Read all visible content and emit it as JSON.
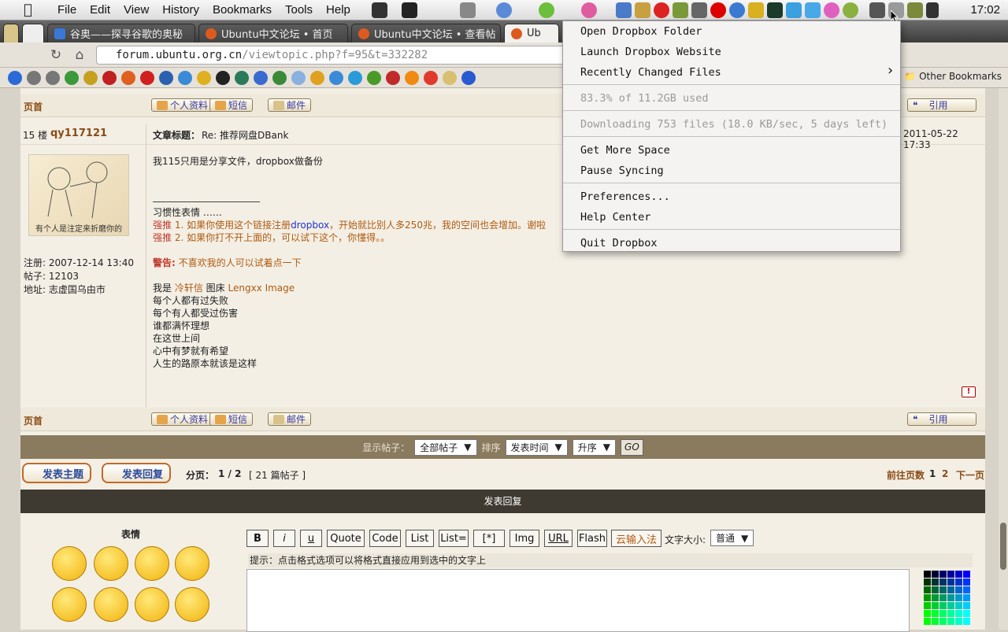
{
  "menubar": {
    "items": [
      "File",
      "Edit",
      "View",
      "History",
      "Bookmarks",
      "Tools",
      "Help"
    ],
    "clock": "17:02"
  },
  "tabs": [
    {
      "label": "谷奥——探寻谷歌的奥秘",
      "color": "#3a78d8"
    },
    {
      "label": "Ubuntu中文论坛 • 首页",
      "color": "#dd5a1e"
    },
    {
      "label": "Ubuntu中文论坛 • 查看帖",
      "color": "#dd5a1e"
    },
    {
      "label": "Ub",
      "color": "#dd5a1e"
    }
  ],
  "address": {
    "host": "forum.ubuntu.org.cn",
    "path": "/viewtopic.php?f=95&t=332282"
  },
  "bookmarks": {
    "other": "Other Bookmarks"
  },
  "post_top": {
    "label": "页首",
    "profile": "个人资料",
    "pm": "短信",
    "email": "邮件",
    "quote": "引用"
  },
  "post": {
    "floor": "15 楼",
    "author": "qy117121",
    "title_label": "文章标题：",
    "title": "Re: 推荐网盘DBank",
    "date": "2011-05-22 17:33",
    "avatar_caption": "有个人是注定来折磨你的",
    "register": "注册: 2007-12-14 13:40",
    "posts": "帖子: 12103",
    "location": "地址: 志虚国乌由市",
    "content": "我115只用是分享文件，dropbox做备份",
    "sig_habit": "习惯性表情 ……",
    "rec_label": "强推",
    "rec1_a": " 1. 如果你使用这个链接注册",
    "rec1_link": "dropbox",
    "rec1_b": "，开始就比别人多250兆，我的空间也会增加。谢啦",
    "rec2": " 2. 如果你打不开上面的，可以试下这个，你懂得。。",
    "warn_label": "警告:",
    "warn": " 不喜欢我的人可以试着点一下",
    "me_prefix": "我是 ",
    "me_name": "冷轩信",
    "me_mid": " 图床 ",
    "me_img": "Lengxx Image",
    "poem": [
      "每个人都有过失败",
      "每个有人都受过伤害",
      "谁都满怀理想",
      "在这世上间",
      "心中有梦就有希望",
      "人生的路原本就该是这样"
    ]
  },
  "post_bottom": {
    "label": "页首",
    "profile": "个人资料",
    "pm": "短信",
    "email": "邮件",
    "quote": "引用"
  },
  "filter": {
    "show_label": "显示帖子：",
    "show_value": "全部帖子",
    "sort_label": "排序",
    "sort_value": "发表时间",
    "order_value": "升序",
    "go": "GO"
  },
  "actions": {
    "new_topic": "发表主题",
    "reply": "发表回复",
    "pages_label": "分页：",
    "pages": "1 / 2",
    "count": "[ 21 篇帖子 ]",
    "goto_label": "前往页数",
    "page1": "1",
    "page2": "2",
    "next": "下一页"
  },
  "reply_header": "发表回复",
  "editor": {
    "smilies_label": "表情",
    "buttons": [
      "B",
      "i",
      "u",
      "Quote",
      "Code",
      "List",
      "List=",
      "[*]",
      "Img",
      "URL",
      "Flash",
      "云输入法"
    ],
    "fontsize_label": "文字大小:",
    "fontsize_value": "普通",
    "hint": "提示：点击格式选项可以将格式直接应用到选中的文字上"
  },
  "dropbox_menu": {
    "open_folder": "Open Dropbox Folder",
    "website": "Launch Dropbox Website",
    "recent": "Recently Changed Files",
    "usage": "83.3% of 11.2GB used",
    "status": "Downloading 753 files (18.0 KB/sec, 5 days left)",
    "more_space": "Get More Space",
    "pause": "Pause Syncing",
    "prefs": "Preferences...",
    "help": "Help Center",
    "quit": "Quit Dropbox"
  }
}
